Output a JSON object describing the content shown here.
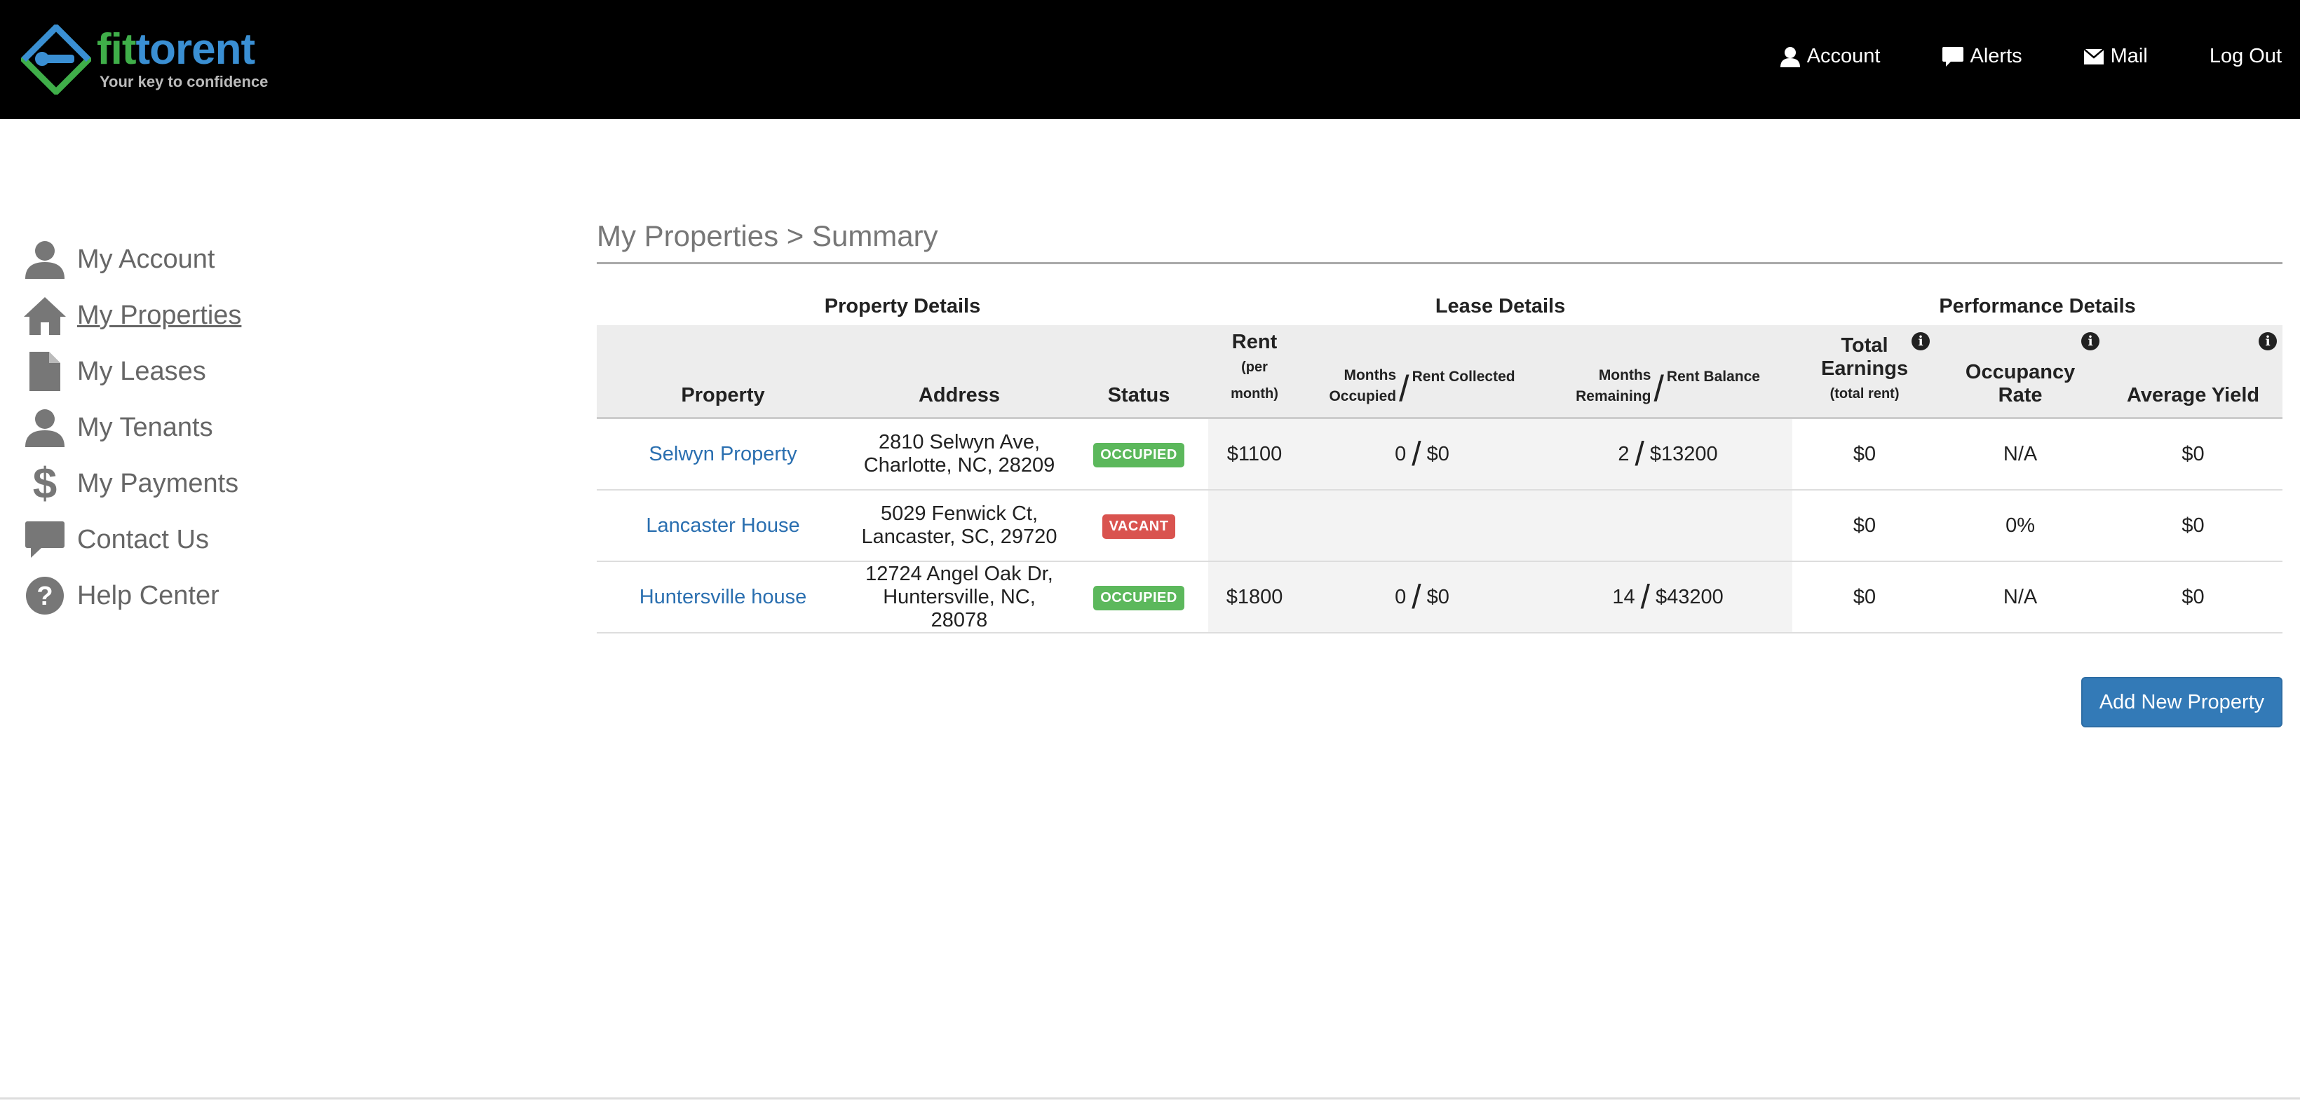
{
  "brand": {
    "part1": "fit",
    "part2": "torent",
    "tagline": "Your key to confidence"
  },
  "topnav": [
    {
      "label": "Account",
      "icon": "user-icon"
    },
    {
      "label": "Alerts",
      "icon": "comment-icon"
    },
    {
      "label": "Mail",
      "icon": "envelope-icon"
    },
    {
      "label": "Log Out",
      "icon": ""
    }
  ],
  "sidebar": [
    {
      "label": "My Account",
      "icon": "user-icon"
    },
    {
      "label": "My Properties",
      "icon": "home-icon",
      "active": true
    },
    {
      "label": "My Leases",
      "icon": "file-icon"
    },
    {
      "label": "My Tenants",
      "icon": "user-icon"
    },
    {
      "label": "My Payments",
      "icon": "dollar-icon"
    },
    {
      "label": "Contact Us",
      "icon": "comment-icon"
    },
    {
      "label": "Help Center",
      "icon": "question-icon"
    }
  ],
  "page": {
    "title": "My Properties > Summary"
  },
  "groups": {
    "property": "Property Details",
    "lease": "Lease Details",
    "performance": "Performance Details"
  },
  "headers": {
    "property": "Property",
    "address": "Address",
    "status": "Status",
    "rent": "Rent",
    "rent_sub1": "(per",
    "rent_sub2": "month)",
    "months_occupied_1": "Months",
    "months_occupied_2": "Occupied",
    "rent_collected": "Rent Collected",
    "months_remaining_1": "Months",
    "months_remaining_2": "Remaining",
    "rent_balance": "Rent Balance",
    "total_1": "Total",
    "total_2": "Earnings",
    "total_sub": "(total rent)",
    "occupancy_1": "Occupancy",
    "occupancy_2": "Rate",
    "yield": "Average Yield",
    "info": "i"
  },
  "rows": [
    {
      "property": "Selwyn Property",
      "address1": "2810 Selwyn Ave,",
      "address2": "Charlotte, NC, 28209",
      "status": "OCCUPIED",
      "rent": "$1100",
      "months_occupied": "0",
      "rent_collected": "$0",
      "months_remaining": "2",
      "rent_balance": "$13200",
      "total": "$0",
      "occupancy": "N/A",
      "yield": "$0"
    },
    {
      "property": "Lancaster House",
      "address1": "5029 Fenwick Ct,",
      "address2": "Lancaster, SC, 29720",
      "status": "VACANT",
      "rent": "",
      "months_occupied": "",
      "rent_collected": "",
      "months_remaining": "",
      "rent_balance": "",
      "total": "$0",
      "occupancy": "0%",
      "yield": "$0"
    },
    {
      "property": "Huntersville house",
      "address1": "12724 Angel Oak Dr,",
      "address2": "Huntersville, NC, 28078",
      "status": "OCCUPIED",
      "rent": "$1800",
      "months_occupied": "0",
      "rent_collected": "$0",
      "months_remaining": "14",
      "rent_balance": "$43200",
      "total": "$0",
      "occupancy": "N/A",
      "yield": "$0"
    }
  ],
  "actions": {
    "add_property": "Add New Property"
  },
  "colors": {
    "link": "#2a6fb0",
    "occupied": "#5cb85c",
    "vacant": "#d9534f",
    "primary": "#337ab7"
  }
}
